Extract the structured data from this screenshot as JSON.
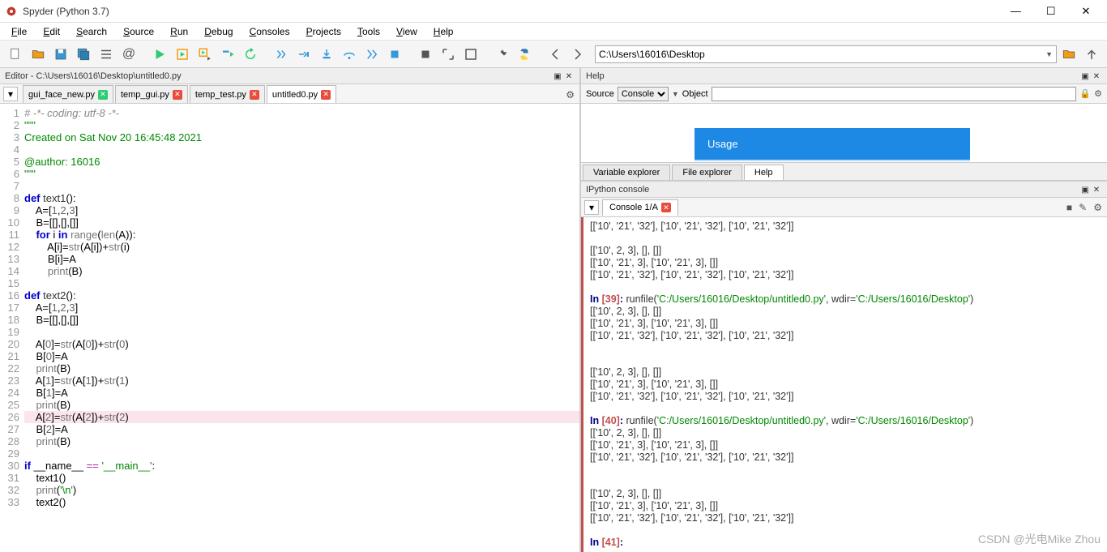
{
  "window": {
    "title": "Spyder (Python 3.7)"
  },
  "menu": [
    "File",
    "Edit",
    "Search",
    "Source",
    "Run",
    "Debug",
    "Consoles",
    "Projects",
    "Tools",
    "View",
    "Help"
  ],
  "path": "C:\\Users\\16016\\Desktop",
  "editor": {
    "pane_title": "Editor - C:\\Users\\16016\\Desktop\\untitled0.py",
    "tabs": [
      {
        "label": "gui_face_new.py",
        "active": false,
        "close": "green"
      },
      {
        "label": "temp_gui.py",
        "active": false,
        "close": "red"
      },
      {
        "label": "temp_test.py",
        "active": false,
        "close": "red"
      },
      {
        "label": "untitled0.py",
        "active": true,
        "close": "red"
      }
    ],
    "highlight_line": 26,
    "lines": [
      {
        "n": 1,
        "html": "<span class='c-gray'># -*- coding: utf-8 -*-</span>"
      },
      {
        "n": 2,
        "html": "<span class='c-green'>\"\"\"</span>"
      },
      {
        "n": 3,
        "html": "<span class='c-green'>Created on Sat Nov 20 16:45:48 2021</span>"
      },
      {
        "n": 4,
        "html": ""
      },
      {
        "n": 5,
        "html": "<span class='c-green'>@author: 16016</span>"
      },
      {
        "n": 6,
        "html": "<span class='c-green'>\"\"\"</span>"
      },
      {
        "n": 7,
        "html": ""
      },
      {
        "n": 8,
        "html": "<span class='c-kw'>def</span> <span class='c-name'>text1</span>():"
      },
      {
        "n": 9,
        "html": "    A=[<span class='c-num'>1</span>,<span class='c-num'>2</span>,<span class='c-num'>3</span>]"
      },
      {
        "n": 10,
        "html": "    B=[[],[],[]]"
      },
      {
        "n": 11,
        "html": "    <span class='c-kw'>for</span> i <span class='c-kw'>in</span> <span class='c-fn'>range</span>(<span class='c-fn'>len</span>(A)):"
      },
      {
        "n": 12,
        "html": "        A[i]=<span class='c-fn'>str</span>(A[i])+<span class='c-fn'>str</span>(i)"
      },
      {
        "n": 13,
        "html": "        B[i]=A"
      },
      {
        "n": 14,
        "html": "        <span class='c-fn'>print</span>(B)"
      },
      {
        "n": 15,
        "html": ""
      },
      {
        "n": 16,
        "html": "<span class='c-kw'>def</span> <span class='c-name'>text2</span>():"
      },
      {
        "n": 17,
        "html": "    A=[<span class='c-num'>1</span>,<span class='c-num'>2</span>,<span class='c-num'>3</span>]"
      },
      {
        "n": 18,
        "html": "    B=[[],[],[]]"
      },
      {
        "n": 19,
        "html": ""
      },
      {
        "n": 20,
        "html": "    A[<span class='c-num'>0</span>]=<span class='c-fn'>str</span>(A[<span class='c-num'>0</span>])+<span class='c-fn'>str</span>(<span class='c-num'>0</span>)"
      },
      {
        "n": 21,
        "html": "    B[<span class='c-num'>0</span>]=A"
      },
      {
        "n": 22,
        "html": "    <span class='c-fn'>print</span>(B)"
      },
      {
        "n": 23,
        "html": "    A[<span class='c-num'>1</span>]=<span class='c-fn'>str</span>(A[<span class='c-num'>1</span>])+<span class='c-fn'>str</span>(<span class='c-num'>1</span>)"
      },
      {
        "n": 24,
        "html": "    B[<span class='c-num'>1</span>]=A"
      },
      {
        "n": 25,
        "html": "    <span class='c-fn'>print</span>(B)"
      },
      {
        "n": 26,
        "html": "    A[<span class='c-num'>2</span>]=<span class='c-fn'>str</span>(A[<span class='c-num'>2</span>])+<span class='c-fn'>str</span>(<span class='c-num'>2</span>)"
      },
      {
        "n": 27,
        "html": "    B[<span class='c-num'>2</span>]=A"
      },
      {
        "n": 28,
        "html": "    <span class='c-fn'>print</span>(B)"
      },
      {
        "n": 29,
        "html": ""
      },
      {
        "n": 30,
        "html": "<span class='c-kw'>if</span> __name__ <span class='c-op'>==</span> <span class='c-str'>'__main__'</span>:"
      },
      {
        "n": 31,
        "html": "    text1()"
      },
      {
        "n": 32,
        "html": "    <span class='c-fn'>print</span>(<span class='c-str'>'\\n'</span>)"
      },
      {
        "n": 33,
        "html": "    text2()"
      }
    ]
  },
  "help": {
    "pane_title": "Help",
    "source_label": "Source",
    "source_value": "Console",
    "object_label": "Object",
    "object_value": "",
    "usage_label": "Usage",
    "tabs": [
      "Variable explorer",
      "File explorer",
      "Help"
    ],
    "active_tab": 2
  },
  "ipython": {
    "pane_title": "IPython console",
    "tab_label": "Console 1/A",
    "lines": [
      "[['10', '21', '32'], ['10', '21', '32'], ['10', '21', '32']]",
      "",
      "[['10', 2, 3], [], []]",
      "[['10', '21', 3], ['10', '21', 3], []]",
      "[['10', '21', '32'], ['10', '21', '32'], ['10', '21', '32']]",
      "",
      {
        "prompt": "In [39]:",
        "cmd": " runfile(",
        "str1": "'C:/Users/16016/Desktop/untitled0.py'",
        "mid": ", wdir=",
        "str2": "'C:/Users/16016/Desktop'",
        "end": ")"
      },
      "[['10', 2, 3], [], []]",
      "[['10', '21', 3], ['10', '21', 3], []]",
      "[['10', '21', '32'], ['10', '21', '32'], ['10', '21', '32']]",
      "",
      "",
      "[['10', 2, 3], [], []]",
      "[['10', '21', 3], ['10', '21', 3], []]",
      "[['10', '21', '32'], ['10', '21', '32'], ['10', '21', '32']]",
      "",
      {
        "prompt": "In [40]:",
        "cmd": " runfile(",
        "str1": "'C:/Users/16016/Desktop/untitled0.py'",
        "mid": ", wdir=",
        "str2": "'C:/Users/16016/Desktop'",
        "end": ")"
      },
      "[['10', 2, 3], [], []]",
      "[['10', '21', 3], ['10', '21', 3], []]",
      "[['10', '21', '32'], ['10', '21', '32'], ['10', '21', '32']]",
      "",
      "",
      "[['10', 2, 3], [], []]",
      "[['10', '21', 3], ['10', '21', 3], []]",
      "[['10', '21', '32'], ['10', '21', '32'], ['10', '21', '32']]",
      "",
      {
        "prompt": "In [41]:",
        "cmd": "",
        "end": ""
      }
    ]
  },
  "watermark": "CSDN @光电Mike Zhou"
}
